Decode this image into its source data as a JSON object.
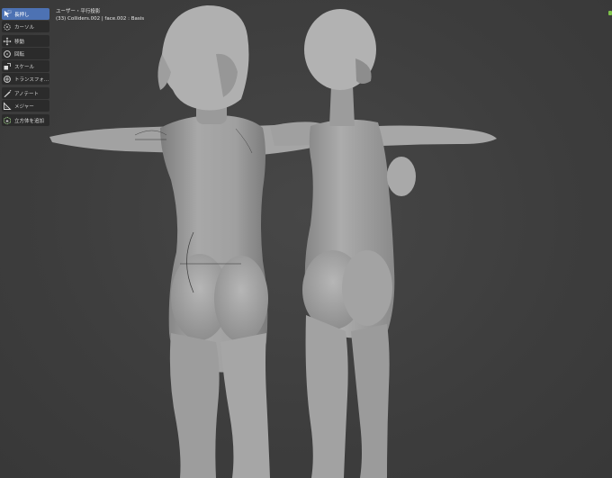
{
  "viewport": {
    "header_line1": "ユーザー・平行投影",
    "header_line2": "(33) Colliders.002 | face.002 : Basis"
  },
  "toolbar": {
    "items": [
      {
        "label": "長押し",
        "icon": "select-box-icon",
        "active": true
      },
      {
        "label": "カーソル",
        "icon": "cursor-icon",
        "active": false
      },
      {
        "label": "移動",
        "icon": "move-icon",
        "active": false
      },
      {
        "label": "回転",
        "icon": "rotate-icon",
        "active": false
      },
      {
        "label": "スケール",
        "icon": "scale-icon",
        "active": false
      },
      {
        "label": "トランスフォ...",
        "icon": "transform-icon",
        "active": false
      },
      {
        "label": "アノテート",
        "icon": "annotate-icon",
        "active": false
      },
      {
        "label": "メジャー",
        "icon": "measure-icon",
        "active": false
      },
      {
        "label": "立方体を追加",
        "icon": "add-cube-icon",
        "active": false
      }
    ]
  },
  "colors": {
    "background": "#3f3f3f",
    "model": "#a3a3a3",
    "active_tool": "#4d72b3",
    "tool_bg": "#2b2b2b",
    "gizmo_green": "#7fc24a"
  }
}
